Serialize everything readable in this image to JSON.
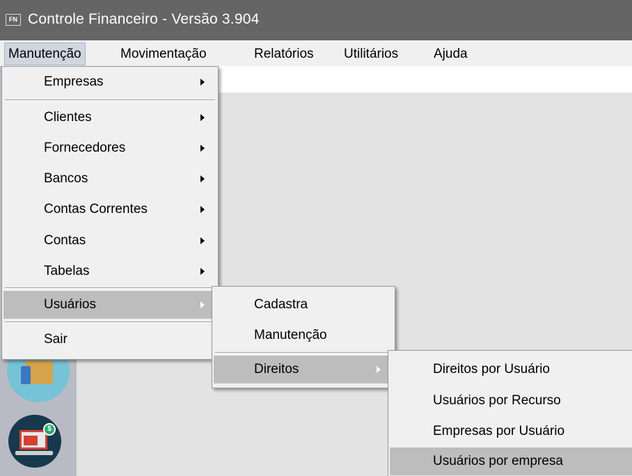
{
  "window": {
    "icon_text": "FN",
    "title": "Controle Financeiro - Versão 3.904"
  },
  "menubar": {
    "items": [
      {
        "label": "Manutenção"
      },
      {
        "label": "Movimentação"
      },
      {
        "label": "Relatórios"
      },
      {
        "label": "Utilitários"
      },
      {
        "label": "Ajuda"
      }
    ]
  },
  "menu_manutencao": {
    "items": [
      {
        "label": "Empresas"
      },
      {
        "label": "Clientes"
      },
      {
        "label": "Fornecedores"
      },
      {
        "label": "Bancos"
      },
      {
        "label": "Contas Correntes"
      },
      {
        "label": "Contas"
      },
      {
        "label": "Tabelas"
      },
      {
        "label": "Usuários"
      },
      {
        "label": "Sair"
      }
    ]
  },
  "menu_usuarios": {
    "items": [
      {
        "label": "Cadastra"
      },
      {
        "label": "Manutenção"
      },
      {
        "label": "Direitos"
      }
    ]
  },
  "menu_direitos": {
    "items": [
      {
        "label": "Direitos por Usuário"
      },
      {
        "label": "Usuários por Recurso"
      },
      {
        "label": "Empresas por Usuário"
      },
      {
        "label": "Usuários por empresa"
      }
    ]
  },
  "desktop_icons": {
    "coin_symbol": "$"
  },
  "colors": {
    "titlebar": "#656565",
    "menu_bg": "#f0f0f0",
    "selected_bg": "#bdbdbd"
  }
}
